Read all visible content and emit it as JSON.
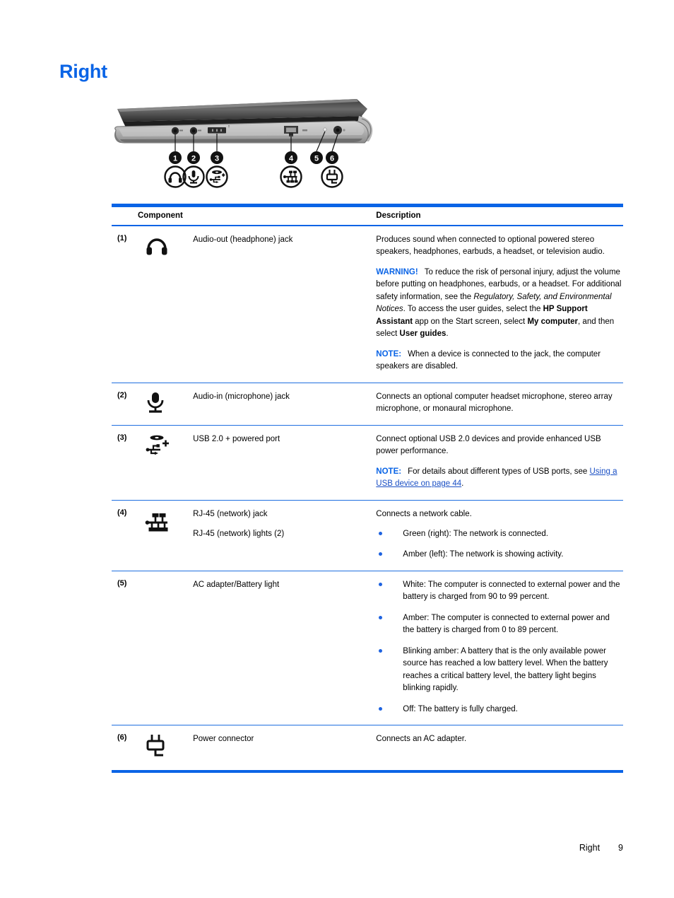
{
  "page": {
    "heading": "Right",
    "footer_label": "Right",
    "footer_page_number": "9",
    "accent_color": "#0a64e6",
    "link_color": "#1a4fc4",
    "bullet_color": "#1e63e0"
  },
  "illustration": {
    "name": "laptop-right-side-profile",
    "callouts": [
      "1",
      "2",
      "3",
      "4",
      "5",
      "6"
    ],
    "callout_icons": [
      "headphone-icon",
      "microphone-icon",
      "usb-powered-icon",
      "rj45-network-icon",
      "power-connector-icon"
    ]
  },
  "table": {
    "headers": {
      "component": "Component",
      "description": "Description"
    },
    "rows": [
      {
        "num": "(1)",
        "icon": "headphone-icon",
        "name": "Audio-out (headphone) jack",
        "desc_paragraphs": [
          {
            "type": "plain",
            "text": "Produces sound when connected to optional powered stereo speakers, headphones, earbuds, a headset, or television audio."
          },
          {
            "type": "warning",
            "keyword": "WARNING!",
            "segments": [
              {
                "style": "normal",
                "text": "To reduce the risk of personal injury, adjust the volume before putting on headphones, earbuds, or a headset. For additional safety information, see the "
              },
              {
                "style": "italic",
                "text": "Regulatory, Safety, and Environmental Notices"
              },
              {
                "style": "normal",
                "text": ". To access the user guides, select the "
              },
              {
                "style": "bold",
                "text": "HP Support Assistant"
              },
              {
                "style": "normal",
                "text": " app on the Start screen, select "
              },
              {
                "style": "bold",
                "text": "My computer"
              },
              {
                "style": "normal",
                "text": ", and then select "
              },
              {
                "style": "bold",
                "text": "User guides"
              },
              {
                "style": "normal",
                "text": "."
              }
            ]
          },
          {
            "type": "note",
            "keyword": "NOTE:",
            "segments": [
              {
                "style": "normal",
                "text": "When a device is connected to the jack, the computer speakers are disabled."
              }
            ]
          }
        ]
      },
      {
        "num": "(2)",
        "icon": "microphone-icon",
        "name": "Audio-in (microphone) jack",
        "desc_paragraphs": [
          {
            "type": "plain",
            "text": "Connects an optional computer headset microphone, stereo array microphone, or monaural microphone."
          }
        ]
      },
      {
        "num": "(3)",
        "icon": "usb-powered-icon",
        "name": "USB 2.0 + powered port",
        "desc_paragraphs": [
          {
            "type": "plain",
            "text": "Connect optional USB 2.0 devices and provide enhanced USB power performance."
          },
          {
            "type": "note",
            "keyword": "NOTE:",
            "segments": [
              {
                "style": "normal",
                "text": "For details about different types of USB ports, see "
              },
              {
                "style": "link",
                "text": "Using a USB device on page 44"
              },
              {
                "style": "normal",
                "text": "."
              }
            ]
          }
        ]
      },
      {
        "num": "(4)",
        "icon": "rj45-network-icon",
        "name": "RJ-45 (network) jack",
        "name_line2": "RJ-45 (network) lights (2)",
        "desc_paragraphs": [
          {
            "type": "plain",
            "text": "Connects a network cable."
          }
        ],
        "bullets": [
          "Green (right): The network is connected.",
          "Amber (left): The network is showing activity."
        ]
      },
      {
        "num": "(5)",
        "icon": "",
        "name": "AC adapter/Battery light",
        "desc_paragraphs": [],
        "bullets": [
          "White: The computer is connected to external power and the battery is charged from 90 to 99 percent.",
          "Amber: The computer is connected to external power and the battery is charged from 0 to 89 percent.",
          "Blinking amber: A battery that is the only available power source has reached a low battery level. When the battery reaches a critical battery level, the battery light begins blinking rapidly.",
          "Off: The battery is fully charged."
        ]
      },
      {
        "num": "(6)",
        "icon": "power-connector-icon",
        "name": "Power connector",
        "desc_paragraphs": [
          {
            "type": "plain",
            "text": "Connects an AC adapter."
          }
        ]
      }
    ]
  }
}
